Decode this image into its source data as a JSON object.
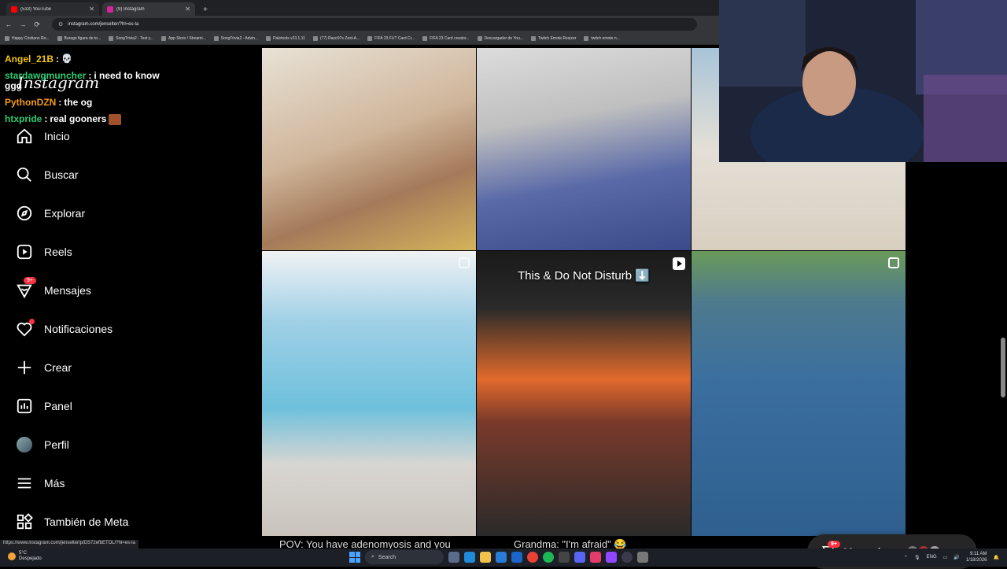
{
  "browser": {
    "tabs": [
      {
        "label": "(533) YouTube",
        "color": "#ff0000",
        "active": false
      },
      {
        "label": "(9) Instagram",
        "color": "#d6249f",
        "active": true
      }
    ],
    "new_tab": "+",
    "nav": {
      "back": "←",
      "forward": "→",
      "reload": "⟳"
    },
    "url": "instagram.com/jenselter/?hl=es-la",
    "bookmarks": [
      "Happy Cristiano Ro...",
      "Burago figura de to...",
      "SongTrivia2 - Test y...",
      "App Store / Streami...",
      "SongTrivia2 - Advin...",
      "Paletools v23.1.11",
      "(77) Razo97s Zest-A...",
      "FIFA 23 FUT Card Cr...",
      "FIFA 23 Card creator...",
      "Descargador de You...",
      "Twitch Emote Resizer",
      "twitch emote n..."
    ]
  },
  "chat": [
    {
      "user": "Angel_21B",
      "color": "#f1c40f",
      "text": ""
    },
    {
      "user": "stardawgmuncher",
      "color": "#2ecc71",
      "text": "i need to know"
    },
    {
      "user": "ggg",
      "color": "#fff",
      "text": ""
    },
    {
      "user": "PythonDZN",
      "color": "#f39c12",
      "text": "the og"
    },
    {
      "user": "htxpride",
      "color": "#2ecc71",
      "text": "real gooners"
    }
  ],
  "sidebar": {
    "logo": "Instagram",
    "items": [
      {
        "label": "Inicio",
        "icon": "home-icon"
      },
      {
        "label": "Buscar",
        "icon": "search-icon"
      },
      {
        "label": "Explorar",
        "icon": "compass-icon"
      },
      {
        "label": "Reels",
        "icon": "reels-icon"
      },
      {
        "label": "Mensajes",
        "icon": "messenger-icon",
        "badge": "9+"
      },
      {
        "label": "Notificaciones",
        "icon": "heart-icon"
      },
      {
        "label": "Crear",
        "icon": "plus-icon"
      },
      {
        "label": "Panel",
        "icon": "dashboard-icon"
      },
      {
        "label": "Perfil",
        "icon": "avatar-icon"
      },
      {
        "label": "Más",
        "icon": "menu-icon"
      },
      {
        "label": "También de Meta",
        "icon": "meta-icon"
      }
    ]
  },
  "grid": {
    "captions": {
      "middle_reel": "This & Do Not Disturb ⬇️",
      "bottom_left": "POV: You have adenomyosis and you",
      "bottom_mid": "Grandma: \"I'm afraid\" 😂"
    }
  },
  "messages_pill": {
    "label": "Mensajes",
    "badge": "9+"
  },
  "status_url": "https://www.instagram.com/jenselter/p/DS72efbETOL/?hl=es-la",
  "taskbar": {
    "weather_temp": "5°C",
    "weather_desc": "Despejado",
    "search": "Search",
    "lang": "ENG",
    "time": "9:11 AM",
    "date": "1/18/2026"
  }
}
